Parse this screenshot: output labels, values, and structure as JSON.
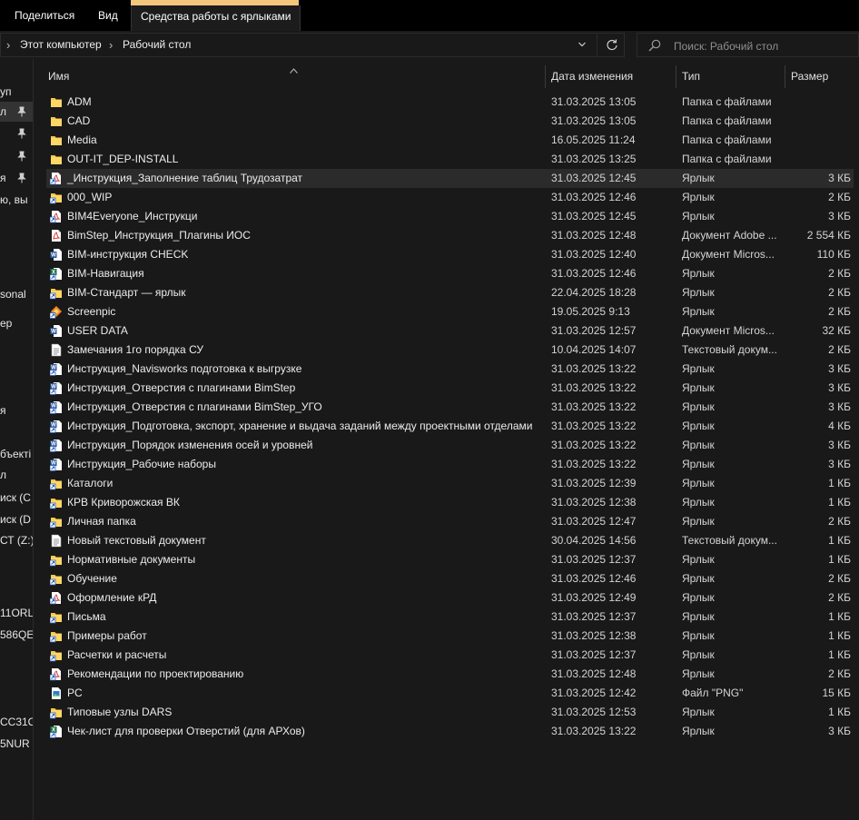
{
  "ribbon": {
    "tabs": [
      "Поделиться",
      "Вид",
      "Средства работы с ярлыками"
    ],
    "context_band_color": "#f3c67e"
  },
  "address": {
    "crumbs": [
      "Этот компьютер",
      "Рабочий стол"
    ]
  },
  "search": {
    "placeholder": "Поиск: Рабочий стол"
  },
  "nav": {
    "items": [
      {
        "text": "уп",
        "pinned": false,
        "selected": false
      },
      {
        "text": "л",
        "pinned": true,
        "selected": true
      },
      {
        "text": "",
        "pinned": true,
        "selected": false
      },
      {
        "text": "",
        "pinned": true,
        "selected": false
      },
      {
        "text": "я",
        "pinned": true,
        "selected": false
      },
      {
        "text": "ю, вы",
        "pinned": false,
        "selected": false
      },
      {
        "text": "sonal",
        "pinned": false,
        "selected": false
      },
      {
        "text": "ер",
        "pinned": false,
        "selected": false
      },
      {
        "text": "я",
        "pinned": false,
        "selected": false
      },
      {
        "text": "бъекті",
        "pinned": false,
        "selected": false
      },
      {
        "text": "л",
        "pinned": false,
        "selected": false
      },
      {
        "text": "иск (C",
        "pinned": false,
        "selected": false
      },
      {
        "text": "иск (D",
        "pinned": false,
        "selected": false
      },
      {
        "text": "СТ (Z:)",
        "pinned": false,
        "selected": false
      },
      {
        "text": "11ORL",
        "pinned": false,
        "selected": false
      },
      {
        "text": "586QE",
        "pinned": false,
        "selected": false
      },
      {
        "text": "CC31O",
        "pinned": false,
        "selected": false
      },
      {
        "text": "5NUR",
        "pinned": false,
        "selected": false
      }
    ]
  },
  "columns": {
    "name": "Имя",
    "date": "Дата изменения",
    "type": "Тип",
    "size": "Размер"
  },
  "files": [
    {
      "name": "ADM",
      "date": "31.03.2025 13:05",
      "type": "Папка с файлами",
      "size": "",
      "icon": "folder-icon"
    },
    {
      "name": "CAD",
      "date": "31.03.2025 13:05",
      "type": "Папка с файлами",
      "size": "",
      "icon": "folder-icon"
    },
    {
      "name": "Media",
      "date": "16.05.2025 11:24",
      "type": "Папка с файлами",
      "size": "",
      "icon": "folder-icon"
    },
    {
      "name": "OUT-IT_DEP-INSTALL",
      "date": "31.03.2025 13:25",
      "type": "Папка с файлами",
      "size": "",
      "icon": "folder-icon"
    },
    {
      "name": "_Инструкция_Заполнение таблиц Трудозатрат",
      "date": "31.03.2025 12:45",
      "type": "Ярлык",
      "size": "3 КБ",
      "icon": "pdf-shortcut-icon"
    },
    {
      "name": "000_WIP",
      "date": "31.03.2025 12:46",
      "type": "Ярлык",
      "size": "2 КБ",
      "icon": "folder-shortcut-icon"
    },
    {
      "name": "BIM4Everyone_Инструкци",
      "date": "31.03.2025 12:45",
      "type": "Ярлык",
      "size": "3 КБ",
      "icon": "pdf-shortcut-icon"
    },
    {
      "name": "BimStep_Инструкция_Плагины ИОС",
      "date": "31.03.2025 12:48",
      "type": "Документ Adobe ...",
      "size": "2 554 КБ",
      "icon": "pdf-icon"
    },
    {
      "name": "BIM-инструкция CHECK",
      "date": "31.03.2025 12:40",
      "type": "Документ Micros...",
      "size": "110 КБ",
      "icon": "word-icon"
    },
    {
      "name": "BIM-Навигация",
      "date": "31.03.2025 12:46",
      "type": "Ярлык",
      "size": "2 КБ",
      "icon": "excel-shortcut-icon"
    },
    {
      "name": "BIM-Стандарт — ярлык",
      "date": "22.04.2025 18:28",
      "type": "Ярлык",
      "size": "2 КБ",
      "icon": "folder-shortcut-icon"
    },
    {
      "name": "Screenpic",
      "date": "19.05.2025 9:13",
      "type": "Ярлык",
      "size": "2 КБ",
      "icon": "app-shortcut-icon"
    },
    {
      "name": "USER DATA",
      "date": "31.03.2025 12:57",
      "type": "Документ Micros...",
      "size": "32 КБ",
      "icon": "word-icon"
    },
    {
      "name": "Замечания 1го порядка СУ",
      "date": "10.04.2025 14:07",
      "type": "Текстовый докум...",
      "size": "2 КБ",
      "icon": "text-file-icon"
    },
    {
      "name": "Инструкция_Navisworks подготовка к выгрузке",
      "date": "31.03.2025 13:22",
      "type": "Ярлык",
      "size": "3 КБ",
      "icon": "word-shortcut-icon"
    },
    {
      "name": "Инструкция_Отверстия с плагинами BimStep",
      "date": "31.03.2025 13:22",
      "type": "Ярлык",
      "size": "3 КБ",
      "icon": "word-shortcut-icon"
    },
    {
      "name": "Инструкция_Отверстия с плагинами BimStep_УГО",
      "date": "31.03.2025 13:22",
      "type": "Ярлык",
      "size": "3 КБ",
      "icon": "word-shortcut-icon"
    },
    {
      "name": "Инструкция_Подготовка, экспорт, хранение и выдача заданий между проектными отделами",
      "date": "31.03.2025 13:22",
      "type": "Ярлык",
      "size": "4 КБ",
      "icon": "word-shortcut-icon"
    },
    {
      "name": "Инструкция_Порядок изменения осей и уровней",
      "date": "31.03.2025 13:22",
      "type": "Ярлык",
      "size": "3 КБ",
      "icon": "word-shortcut-icon"
    },
    {
      "name": "Инструкция_Рабочие наборы",
      "date": "31.03.2025 13:22",
      "type": "Ярлык",
      "size": "3 КБ",
      "icon": "word-shortcut-icon"
    },
    {
      "name": "Каталоги",
      "date": "31.03.2025 12:39",
      "type": "Ярлык",
      "size": "1 КБ",
      "icon": "folder-shortcut-icon"
    },
    {
      "name": "КРВ Криворожская ВК",
      "date": "31.03.2025 12:38",
      "type": "Ярлык",
      "size": "1 КБ",
      "icon": "folder-shortcut-icon"
    },
    {
      "name": "Личная папка",
      "date": "31.03.2025 12:47",
      "type": "Ярлык",
      "size": "2 КБ",
      "icon": "folder-shortcut-icon"
    },
    {
      "name": "Новый текстовый документ",
      "date": "30.04.2025 14:56",
      "type": "Текстовый докум...",
      "size": "1 КБ",
      "icon": "text-file-icon"
    },
    {
      "name": "Нормативные документы",
      "date": "31.03.2025 12:37",
      "type": "Ярлык",
      "size": "1 КБ",
      "icon": "folder-shortcut-icon"
    },
    {
      "name": "Обучение",
      "date": "31.03.2025 12:46",
      "type": "Ярлык",
      "size": "2 КБ",
      "icon": "folder-shortcut-icon"
    },
    {
      "name": "Оформление кРД",
      "date": "31.03.2025 12:49",
      "type": "Ярлык",
      "size": "2 КБ",
      "icon": "pdf-shortcut-icon"
    },
    {
      "name": "Письма",
      "date": "31.03.2025 12:37",
      "type": "Ярлык",
      "size": "1 КБ",
      "icon": "folder-shortcut-icon"
    },
    {
      "name": "Примеры работ",
      "date": "31.03.2025 12:38",
      "type": "Ярлык",
      "size": "1 КБ",
      "icon": "folder-shortcut-icon"
    },
    {
      "name": "Расчетки и расчеты",
      "date": "31.03.2025 12:37",
      "type": "Ярлык",
      "size": "1 КБ",
      "icon": "folder-shortcut-icon"
    },
    {
      "name": "Рекомендации по проектированию",
      "date": "31.03.2025 12:48",
      "type": "Ярлык",
      "size": "2 КБ",
      "icon": "pdf-shortcut-icon"
    },
    {
      "name": "PC",
      "date": "31.03.2025 12:42",
      "type": "Файл \"PNG\"",
      "size": "15 КБ",
      "icon": "image-file-icon"
    },
    {
      "name": "Типовые узлы DARS",
      "date": "31.03.2025 12:53",
      "type": "Ярлык",
      "size": "1 КБ",
      "icon": "folder-shortcut-icon"
    },
    {
      "name": "Чек-лист для проверки Отверстий (для АРХов)",
      "date": "31.03.2025 13:22",
      "type": "Ярлык",
      "size": "3 КБ",
      "icon": "excel-shortcut-icon"
    }
  ]
}
